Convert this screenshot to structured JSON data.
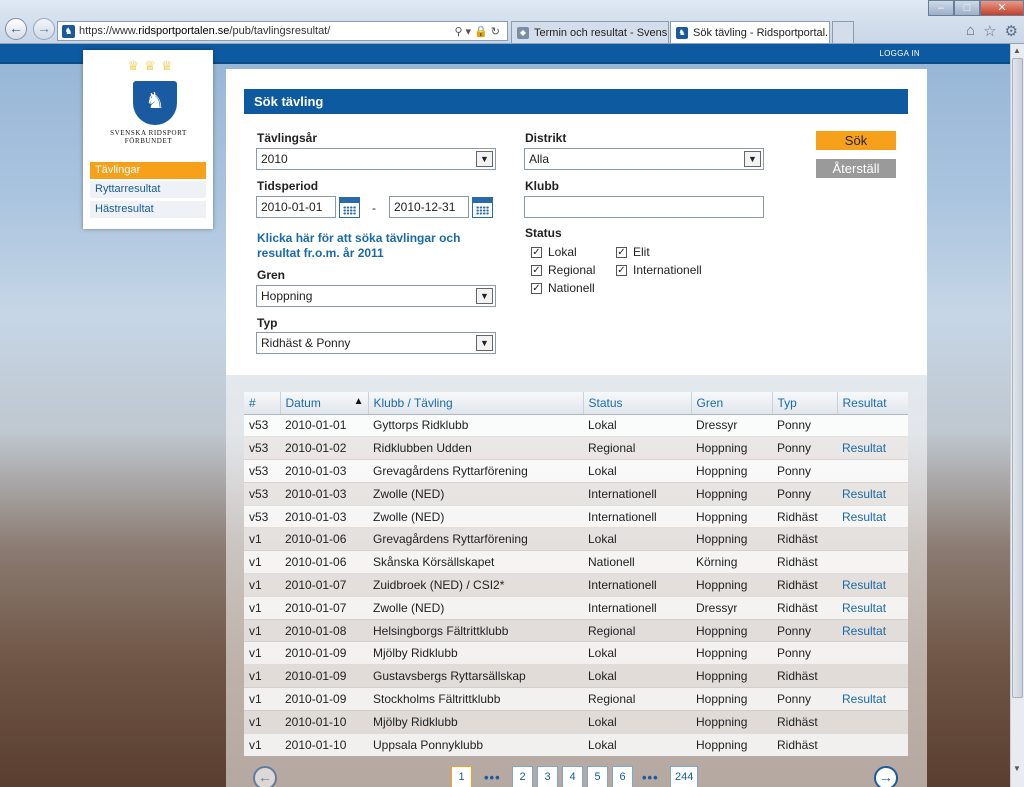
{
  "browser": {
    "url_prefix": "https://www.",
    "url_host": "ridsportportalen.se",
    "url_path": "/pub/tavlingsresultat/",
    "tabs": [
      {
        "label": "Termin och resultat - Svenska ..."
      },
      {
        "label": "Sök tävling - Ridsportportal..."
      }
    ]
  },
  "topbar": {
    "login": "LOGGA IN"
  },
  "logo": {
    "line1": "SVENSKA RIDSPORT",
    "line2": "FÖRBUNDET"
  },
  "nav": {
    "items": [
      {
        "label": "Tävlingar",
        "active": true
      },
      {
        "label": "Ryttarresultat",
        "active": false
      },
      {
        "label": "Hästresultat",
        "active": false
      }
    ]
  },
  "form": {
    "title": "Sök tävling",
    "year_label": "Tävlingsår",
    "year_value": "2010",
    "period_label": "Tidsperiod",
    "period_from": "2010-01-01",
    "period_dash": "-",
    "period_to": "2010-12-31",
    "link_2011": "Klicka här för att söka tävlingar och resultat fr.o.m. år 2011",
    "gren_label": "Gren",
    "gren_value": "Hoppning",
    "typ_label": "Typ",
    "typ_value": "Ridhäst & Ponny",
    "distrikt_label": "Distrikt",
    "distrikt_value": "Alla",
    "klubb_label": "Klubb",
    "klubb_value": "",
    "status_label": "Status",
    "status_options": [
      {
        "label": "Lokal",
        "checked": true
      },
      {
        "label": "Regional",
        "checked": true
      },
      {
        "label": "Nationell",
        "checked": true
      },
      {
        "label": "Elit",
        "checked": true
      },
      {
        "label": "Internationell",
        "checked": true
      }
    ],
    "search_button": "Sök",
    "reset_button": "Återställ"
  },
  "table": {
    "headers": [
      "#",
      "Datum",
      "Klubb / Tävling",
      "Status",
      "Gren",
      "Typ",
      "Resultat"
    ],
    "rows": [
      [
        "v53",
        "2010-01-01",
        "Gyttorps Ridklubb",
        "Lokal",
        "Dressyr",
        "Ponny",
        ""
      ],
      [
        "v53",
        "2010-01-02",
        "Ridklubben Udden",
        "Regional",
        "Hoppning",
        "Ponny",
        "Resultat"
      ],
      [
        "v53",
        "2010-01-03",
        "Grevagårdens Ryttarförening",
        "Lokal",
        "Hoppning",
        "Ponny",
        ""
      ],
      [
        "v53",
        "2010-01-03",
        "Zwolle (NED)",
        "Internationell",
        "Hoppning",
        "Ponny",
        "Resultat"
      ],
      [
        "v53",
        "2010-01-03",
        "Zwolle (NED)",
        "Internationell",
        "Hoppning",
        "Ridhäst",
        "Resultat"
      ],
      [
        "v1",
        "2010-01-06",
        "Grevagårdens Ryttarförening",
        "Lokal",
        "Hoppning",
        "Ridhäst",
        ""
      ],
      [
        "v1",
        "2010-01-06",
        "Skånska Körsällskapet",
        "Nationell",
        "Körning",
        "Ridhäst",
        ""
      ],
      [
        "v1",
        "2010-01-07",
        "Zuidbroek (NED) / CSI2*",
        "Internationell",
        "Hoppning",
        "Ridhäst",
        "Resultat"
      ],
      [
        "v1",
        "2010-01-07",
        "Zwolle (NED)",
        "Internationell",
        "Dressyr",
        "Ridhäst",
        "Resultat"
      ],
      [
        "v1",
        "2010-01-08",
        "Helsingborgs Fältrittklubb",
        "Regional",
        "Hoppning",
        "Ponny",
        "Resultat"
      ],
      [
        "v1",
        "2010-01-09",
        "Mjölby Ridklubb",
        "Lokal",
        "Hoppning",
        "Ponny",
        ""
      ],
      [
        "v1",
        "2010-01-09",
        "Gustavsbergs Ryttarsällskap",
        "Lokal",
        "Hoppning",
        "Ridhäst",
        ""
      ],
      [
        "v1",
        "2010-01-09",
        "Stockholms Fältrittklubb",
        "Regional",
        "Hoppning",
        "Ponny",
        "Resultat"
      ],
      [
        "v1",
        "2010-01-10",
        "Mjölby Ridklubb",
        "Lokal",
        "Hoppning",
        "Ridhäst",
        ""
      ],
      [
        "v1",
        "2010-01-10",
        "Uppsala Ponnyklubb",
        "Lokal",
        "Hoppning",
        "Ridhäst",
        ""
      ]
    ]
  },
  "pager": {
    "current": "1",
    "pages": [
      "2",
      "3",
      "4",
      "5",
      "6"
    ],
    "last": "244",
    "dots": "•••"
  },
  "icons": {
    "back": "back-arrow-icon",
    "forward": "forward-arrow-icon",
    "calendar": "calendar-icon",
    "sort": "sort-ascending-icon"
  },
  "colors": {
    "brand_blue": "#0d5aa0",
    "accent_orange": "#f7a11a",
    "link_blue": "#1a6aa8"
  }
}
